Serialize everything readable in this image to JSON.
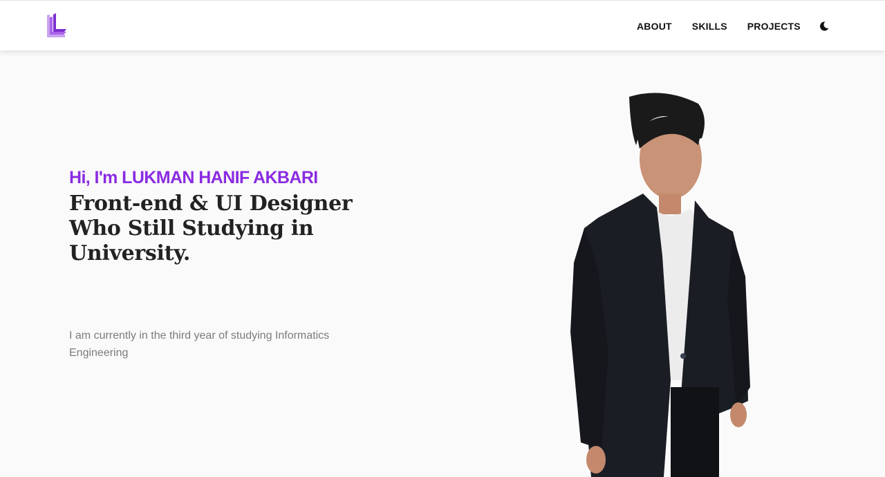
{
  "nav": {
    "links": [
      "ABOUT",
      "SKILLS",
      "PROJECTS"
    ],
    "logo_icon": "stacked-L-logo",
    "theme_icon": "moon-icon"
  },
  "hero": {
    "greeting": "Hi, I'm LUKMAN HANIF AKBARI",
    "headline": "Front-end & UI Designer Who Still Studying in University.",
    "subtext": "I am currently in the third year of studying Informatics Engineering",
    "portrait_icon": "person-portrait"
  },
  "colors": {
    "accent": "#8a2be2",
    "background": "#fafafa",
    "navbar": "#ffffff",
    "heading": "#222222",
    "body_text": "#7b7b7b"
  }
}
